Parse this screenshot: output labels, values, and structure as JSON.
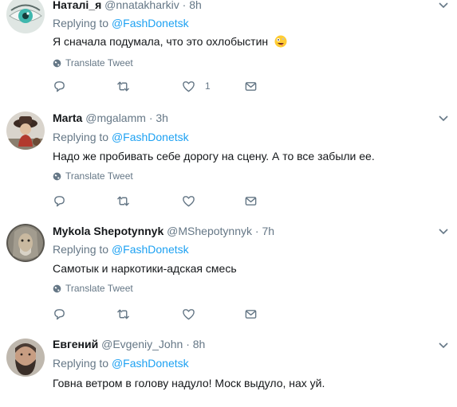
{
  "tweets": [
    {
      "name": "Наталі_я",
      "handle": "@nnatakharkiv",
      "dot": "·",
      "time": "8h",
      "replying_label": "Replying to",
      "replying_to": "@FashDonetsk",
      "text": "Я сначала подумала, что это охлобыстин",
      "has_emoji": "zany-face",
      "translate": "Translate Tweet",
      "like_count": "1"
    },
    {
      "name": "Marta",
      "handle": "@mgalamm",
      "dot": "·",
      "time": "3h",
      "replying_label": "Replying to",
      "replying_to": "@FashDonetsk",
      "text": "Надо же пробивать себе дорогу на сцену. А то все забыли ее.",
      "translate": "Translate Tweet",
      "like_count": ""
    },
    {
      "name": "Mykola Shepotynnyk",
      "handle": "@MShepotynnyk",
      "dot": "·",
      "time": "7h",
      "replying_label": "Replying to",
      "replying_to": "@FashDonetsk",
      "text": "Самотык и наркотики-адская смесь",
      "translate": "Translate Tweet",
      "like_count": ""
    },
    {
      "name": "Евгений",
      "handle": "@Evgeniy_John",
      "dot": "·",
      "time": "8h",
      "replying_label": "Replying to",
      "replying_to": "@FashDonetsk",
      "text": "Говна ветром в голову надуло! Моск выдуло, нах уй."
    }
  ],
  "icons": {
    "more": "chevron-down-icon",
    "globe": "globe-icon",
    "reply": "reply-icon",
    "retweet": "retweet-icon",
    "like": "heart-icon",
    "dm": "envelope-icon"
  },
  "colors": {
    "link": "#1da1f2",
    "muted": "#657786",
    "divider": "#e6ecf0"
  }
}
